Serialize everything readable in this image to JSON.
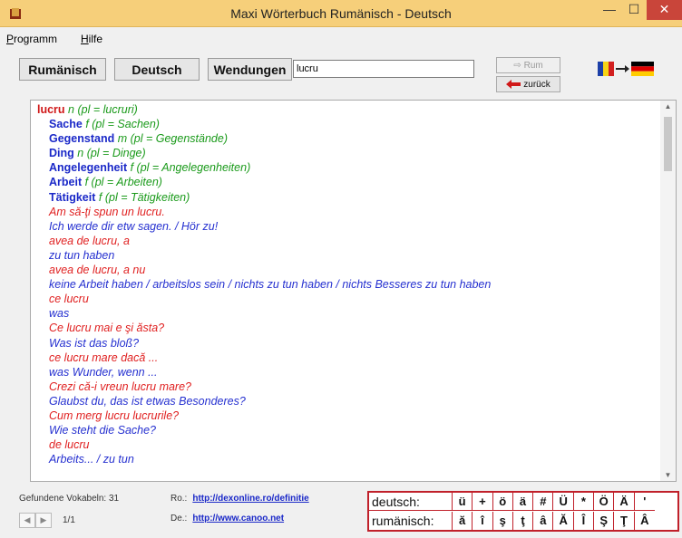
{
  "window": {
    "title": "Maxi Wörterbuch Rumänisch - Deutsch",
    "minimize": "—",
    "maximize": "☐",
    "close": "✕"
  },
  "menu": {
    "programm_u": "P",
    "programm_rest": "rogramm",
    "hilfe_u": "H",
    "hilfe_rest": "ilfe"
  },
  "toolbar": {
    "btn_ro": "Rumänisch",
    "btn_de": "Deutsch",
    "btn_phrases": "Wendungen",
    "search_value": "lucru",
    "rum_label": "Rum",
    "back_label": "zurück"
  },
  "entry": {
    "headword": "lucru",
    "headword_gram": "n (pl = lucruri)",
    "translations": [
      {
        "word": "Sache",
        "gram": "f (pl = Sachen)"
      },
      {
        "word": "Gegenstand",
        "gram": "m (pl = Gegenstände)"
      },
      {
        "word": "Ding",
        "gram": "n (pl = Dinge)"
      },
      {
        "word": "Angelegenheit",
        "gram": "f (pl = Angelegenheiten)"
      },
      {
        "word": "Arbeit",
        "gram": "f (pl = Arbeiten)"
      },
      {
        "word": "Tätigkeit",
        "gram": "f (pl = Tätigkeiten)"
      }
    ],
    "examples": [
      {
        "lang": "ro",
        "text": "Am să-ţi spun un lucru."
      },
      {
        "lang": "de",
        "text": "Ich werde dir etw sagen. / Hör zu!"
      },
      {
        "lang": "ro",
        "text": "avea de lucru, a"
      },
      {
        "lang": "de",
        "text": "zu tun haben"
      },
      {
        "lang": "ro",
        "text": "avea de lucru, a nu"
      },
      {
        "lang": "de",
        "text": "keine Arbeit haben / arbeitslos sein / nichts zu tun haben / nichts Besseres zu tun haben"
      },
      {
        "lang": "ro",
        "text": "ce lucru"
      },
      {
        "lang": "de",
        "text": "was"
      },
      {
        "lang": "ro",
        "text": "Ce lucru mai e şi ăsta?"
      },
      {
        "lang": "de",
        "text": "Was ist das bloß?"
      },
      {
        "lang": "ro",
        "text": "ce lucru mare dacă ..."
      },
      {
        "lang": "de",
        "text": "was Wunder, wenn ..."
      },
      {
        "lang": "ro",
        "text": "Crezi că-i vreun lucru mare?"
      },
      {
        "lang": "de",
        "text": "Glaubst du, das ist etwas Besonderes?"
      },
      {
        "lang": "ro",
        "text": "Cum merg lucru lucrurile?"
      },
      {
        "lang": "de",
        "text": "Wie steht die Sache?"
      },
      {
        "lang": "ro",
        "text": "de lucru"
      },
      {
        "lang": "de",
        "text": "Arbeits... / zu tun"
      }
    ]
  },
  "status": {
    "count_label": "Gefundene Vokabeln: 31",
    "page": "1/1",
    "ro_prefix": "Ro.:",
    "ro_link": "http://dexonline.ro/definitie",
    "de_prefix": "De.:",
    "de_link": "http://www.canoo.net"
  },
  "char_panel": {
    "de_label": "deutsch:",
    "de_chars": [
      "ü",
      "+",
      "ö",
      "ä",
      "#",
      "Ü",
      "*",
      "Ö",
      "Ä",
      "'"
    ],
    "ro_label": "rumänisch:",
    "ro_chars": [
      "ă",
      "î",
      "ş",
      "ţ",
      "â",
      "Ă",
      "Î",
      "Ş",
      "Ţ",
      "Â"
    ]
  },
  "colors": {
    "titlebar": "#f6cf7a",
    "headword": "#d01818",
    "grammar": "#1a9a1a",
    "translation": "#1a28c8",
    "example_ro": "#e02020",
    "example_de": "#2530d0",
    "panel_border": "#c0202a"
  }
}
